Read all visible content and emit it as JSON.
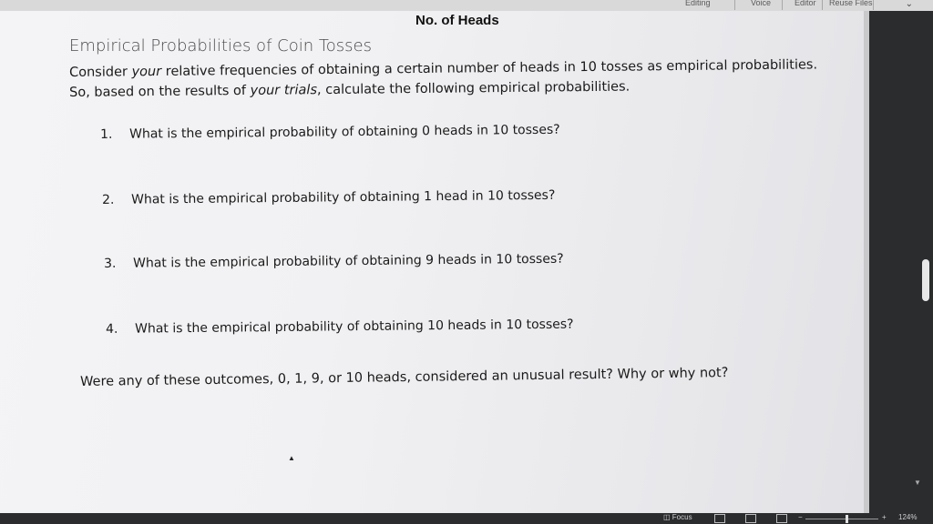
{
  "ribbon": {
    "editing_label": "Editing",
    "voice_label": "Voice",
    "editor_label": "Editor",
    "reuse_files_label": "Reuse Files"
  },
  "table_header": "No. of Heads",
  "document": {
    "title": "Empirical Probabilities of Coin Tosses",
    "intro_line1_pre": "Consider ",
    "intro_line1_em": "your",
    "intro_line1_post": " relative frequencies of obtaining a certain number of heads in 10 tosses as empirical probabilities.",
    "intro_line2_pre": "So, based on the results of ",
    "intro_line2_em": "your trials",
    "intro_line2_post": ", calculate the following empirical probabilities.",
    "questions": [
      {
        "num": "1.",
        "text": "What is the empirical probability of obtaining 0 heads in 10 tosses?"
      },
      {
        "num": "2.",
        "text": "What is the empirical probability of obtaining 1 head in 10 tosses?"
      },
      {
        "num": "3.",
        "text": "What is the empirical probability of obtaining 9 heads in 10 tosses?"
      },
      {
        "num": "4.",
        "text": "What is the empirical probability of obtaining 10 heads in 10 tosses?"
      }
    ],
    "closing": "Were any of these outcomes, 0, 1, 9, or 10 heads, considered an unusual result? Why or why not?"
  },
  "status_bar": {
    "focus_label": "Focus",
    "zoom_minus": "−",
    "zoom_plus": "+",
    "zoom_level": "124%"
  }
}
